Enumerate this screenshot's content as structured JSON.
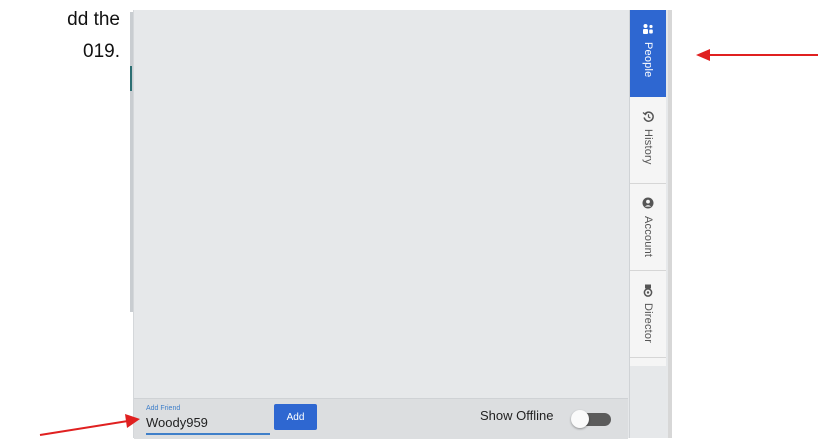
{
  "document": {
    "line1": "dd the",
    "line2": "019."
  },
  "sidebar": {
    "tabs": [
      {
        "label": "People",
        "icon": "people-icon",
        "active": true
      },
      {
        "label": "History",
        "icon": "history-icon",
        "active": false
      },
      {
        "label": "Account",
        "icon": "account-icon",
        "active": false
      },
      {
        "label": "Director",
        "icon": "director-icon",
        "active": false
      }
    ]
  },
  "friend": {
    "label": "Add Friend",
    "value": "Woody959",
    "add_label": "Add"
  },
  "offline": {
    "label": "Show Offline",
    "enabled": false
  },
  "colors": {
    "accent": "#2e67d1",
    "annotation_arrow": "#e02020"
  }
}
